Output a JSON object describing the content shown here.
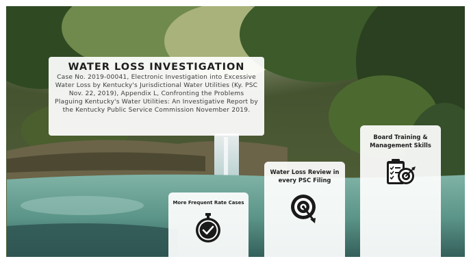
{
  "slide": {
    "title": "WATER LOSS INVESTIGATION",
    "subtitle": "Case No. 2019-00041, Electronic Investigation into Excessive Water Loss by Kentucky's Jurisdictional Water Utilities (Ky. PSC Nov. 22, 2019), Appendix L, Confronting the Problems Plaguing Kentucky's Water Utilities: An Investigative Report by the Kentucky Public Service Commission November 2019."
  },
  "cards": [
    {
      "label": "More Frequent Rate Cases",
      "icon": "stopwatch-icon"
    },
    {
      "label": "Water Loss Review in every PSC Filing",
      "icon": "target-icon"
    },
    {
      "label": "Board Training & Management Skills",
      "icon": "clipboard-target-icon"
    }
  ],
  "colors": {
    "card_background": "#ffffff",
    "title_text": "#1e1e1e",
    "icon_dark": "#1a1a1a"
  }
}
